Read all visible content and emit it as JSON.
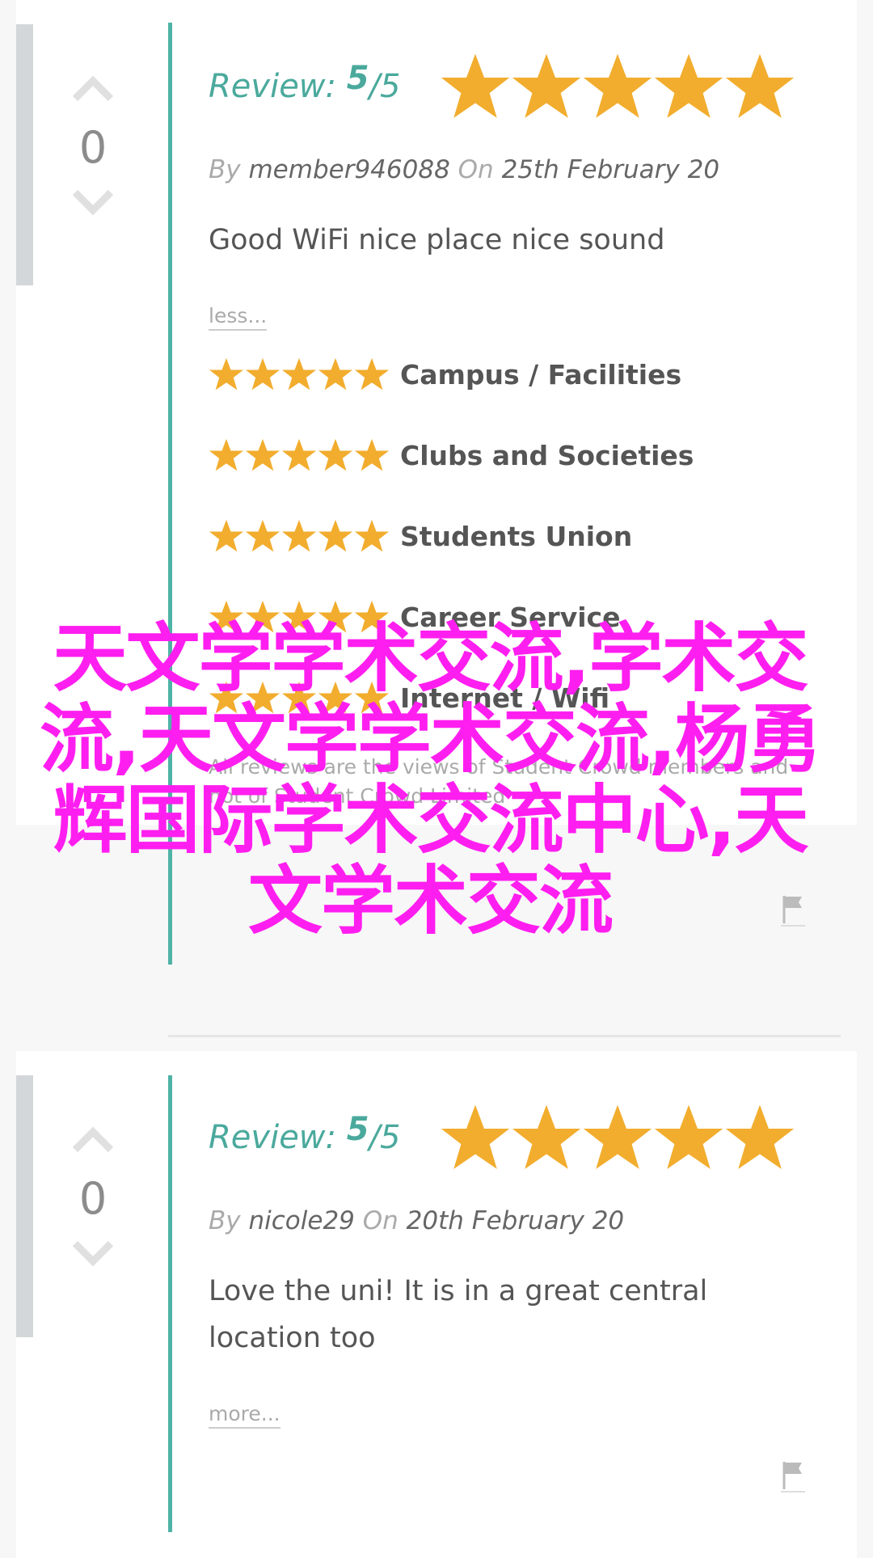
{
  "reviews": [
    {
      "votes": "0",
      "review_label": "Review:",
      "score": "5",
      "out_of": "/5",
      "by_label": "By",
      "author": "member946088",
      "on_label": "On",
      "date": "25th February 20",
      "text": "Good WiFi nice place nice sound",
      "toggle": "less...",
      "categories": [
        {
          "label": "Campus / Facilities",
          "rating": 5
        },
        {
          "label": "Clubs and Societies",
          "rating": 5
        },
        {
          "label": "Students Union",
          "rating": 5
        },
        {
          "label": "Career Service",
          "rating": 5
        },
        {
          "label": "Internet / Wifi",
          "rating": 5
        }
      ],
      "disclaimer": "All reviews are the views of Student Crowd members and not of Student Crowd Limited"
    },
    {
      "votes": "0",
      "review_label": "Review:",
      "score": "5",
      "out_of": "/5",
      "by_label": "By",
      "author": "nicole29",
      "on_label": "On",
      "date": "20th February 20",
      "text": "Love the uni! It is in a great central location too",
      "toggle": "more..."
    }
  ],
  "watermark": "天文学学术交流,学术交流,天文学学术交流,杨勇辉国际学术交流中心,天文学术交流",
  "colors": {
    "accent": "#4aa99c",
    "star": "#f2ad2e",
    "watermark": "#ff1ef0",
    "vote_bar": "#d4d7da"
  },
  "icons": {
    "vote_up": "chevron-up-icon",
    "vote_down": "chevron-down-icon",
    "star": "star-icon",
    "report": "flag-icon"
  }
}
